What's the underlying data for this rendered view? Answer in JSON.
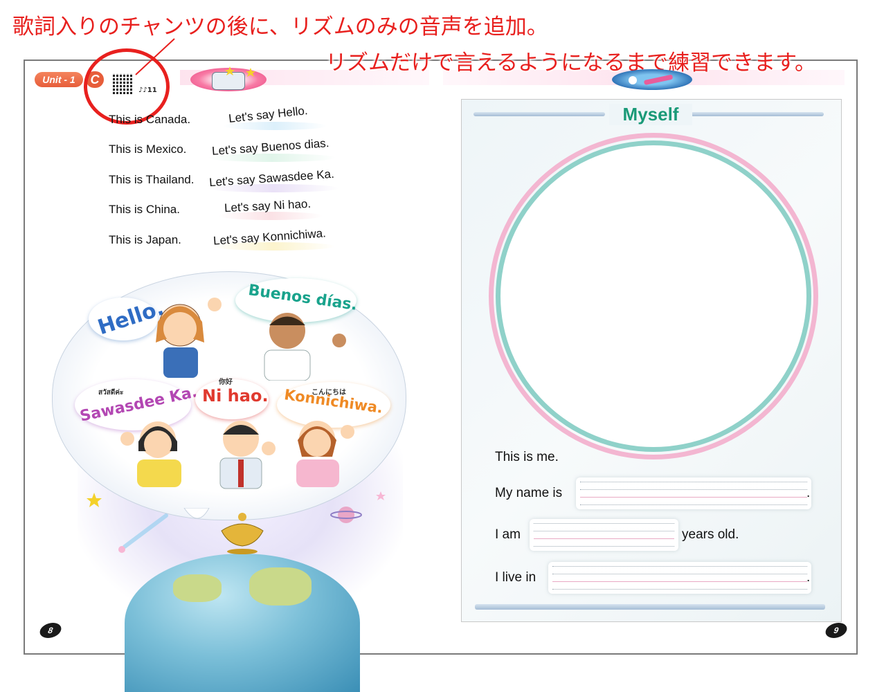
{
  "annotations": {
    "line1": "歌詞入りのチャンツの後に、リズムのみの音声を追加。",
    "line2": "リズムだけで言えるようになるまで練習できます。"
  },
  "header": {
    "unit_label": "Unit - 1",
    "section_letter": "C",
    "track_label": "♪♪11"
  },
  "chant": {
    "rows": [
      {
        "country": "This is Canada.",
        "say": "Let's say Hello."
      },
      {
        "country": "This is Mexico.",
        "say": "Let's say Buenos dias."
      },
      {
        "country": "This is Thailand.",
        "say": "Let's say Sawasdee Ka."
      },
      {
        "country": "This is China.",
        "say": "Let's say Ni hao."
      },
      {
        "country": "This is Japan.",
        "say": "Let's say Konnichiwa."
      }
    ]
  },
  "illustration": {
    "greetings": {
      "hello": "Hello.",
      "buenos": "Buenos días.",
      "sawasdee": "Sawasdee Ka.",
      "sawasdee_native": "สวัสดีค่ะ",
      "nihao": "Ni hao.",
      "nihao_native": "你好",
      "konnichiwa": "Konnichiwa.",
      "konnichiwa_native": "こんにちは"
    }
  },
  "pages": {
    "left": "8",
    "right": "9"
  },
  "right_page": {
    "title": "Myself",
    "lines": {
      "this_is_me": "This is me.",
      "my_name_is": "My name is",
      "i_am": "I am",
      "years_old": "years old.",
      "i_live_in": "I live in",
      "period": "."
    }
  },
  "colors": {
    "annotation_red": "#e8201e",
    "title_green": "#1a9a78",
    "ring_pink": "#f3b6d1",
    "ring_teal": "#8fd1c9"
  }
}
